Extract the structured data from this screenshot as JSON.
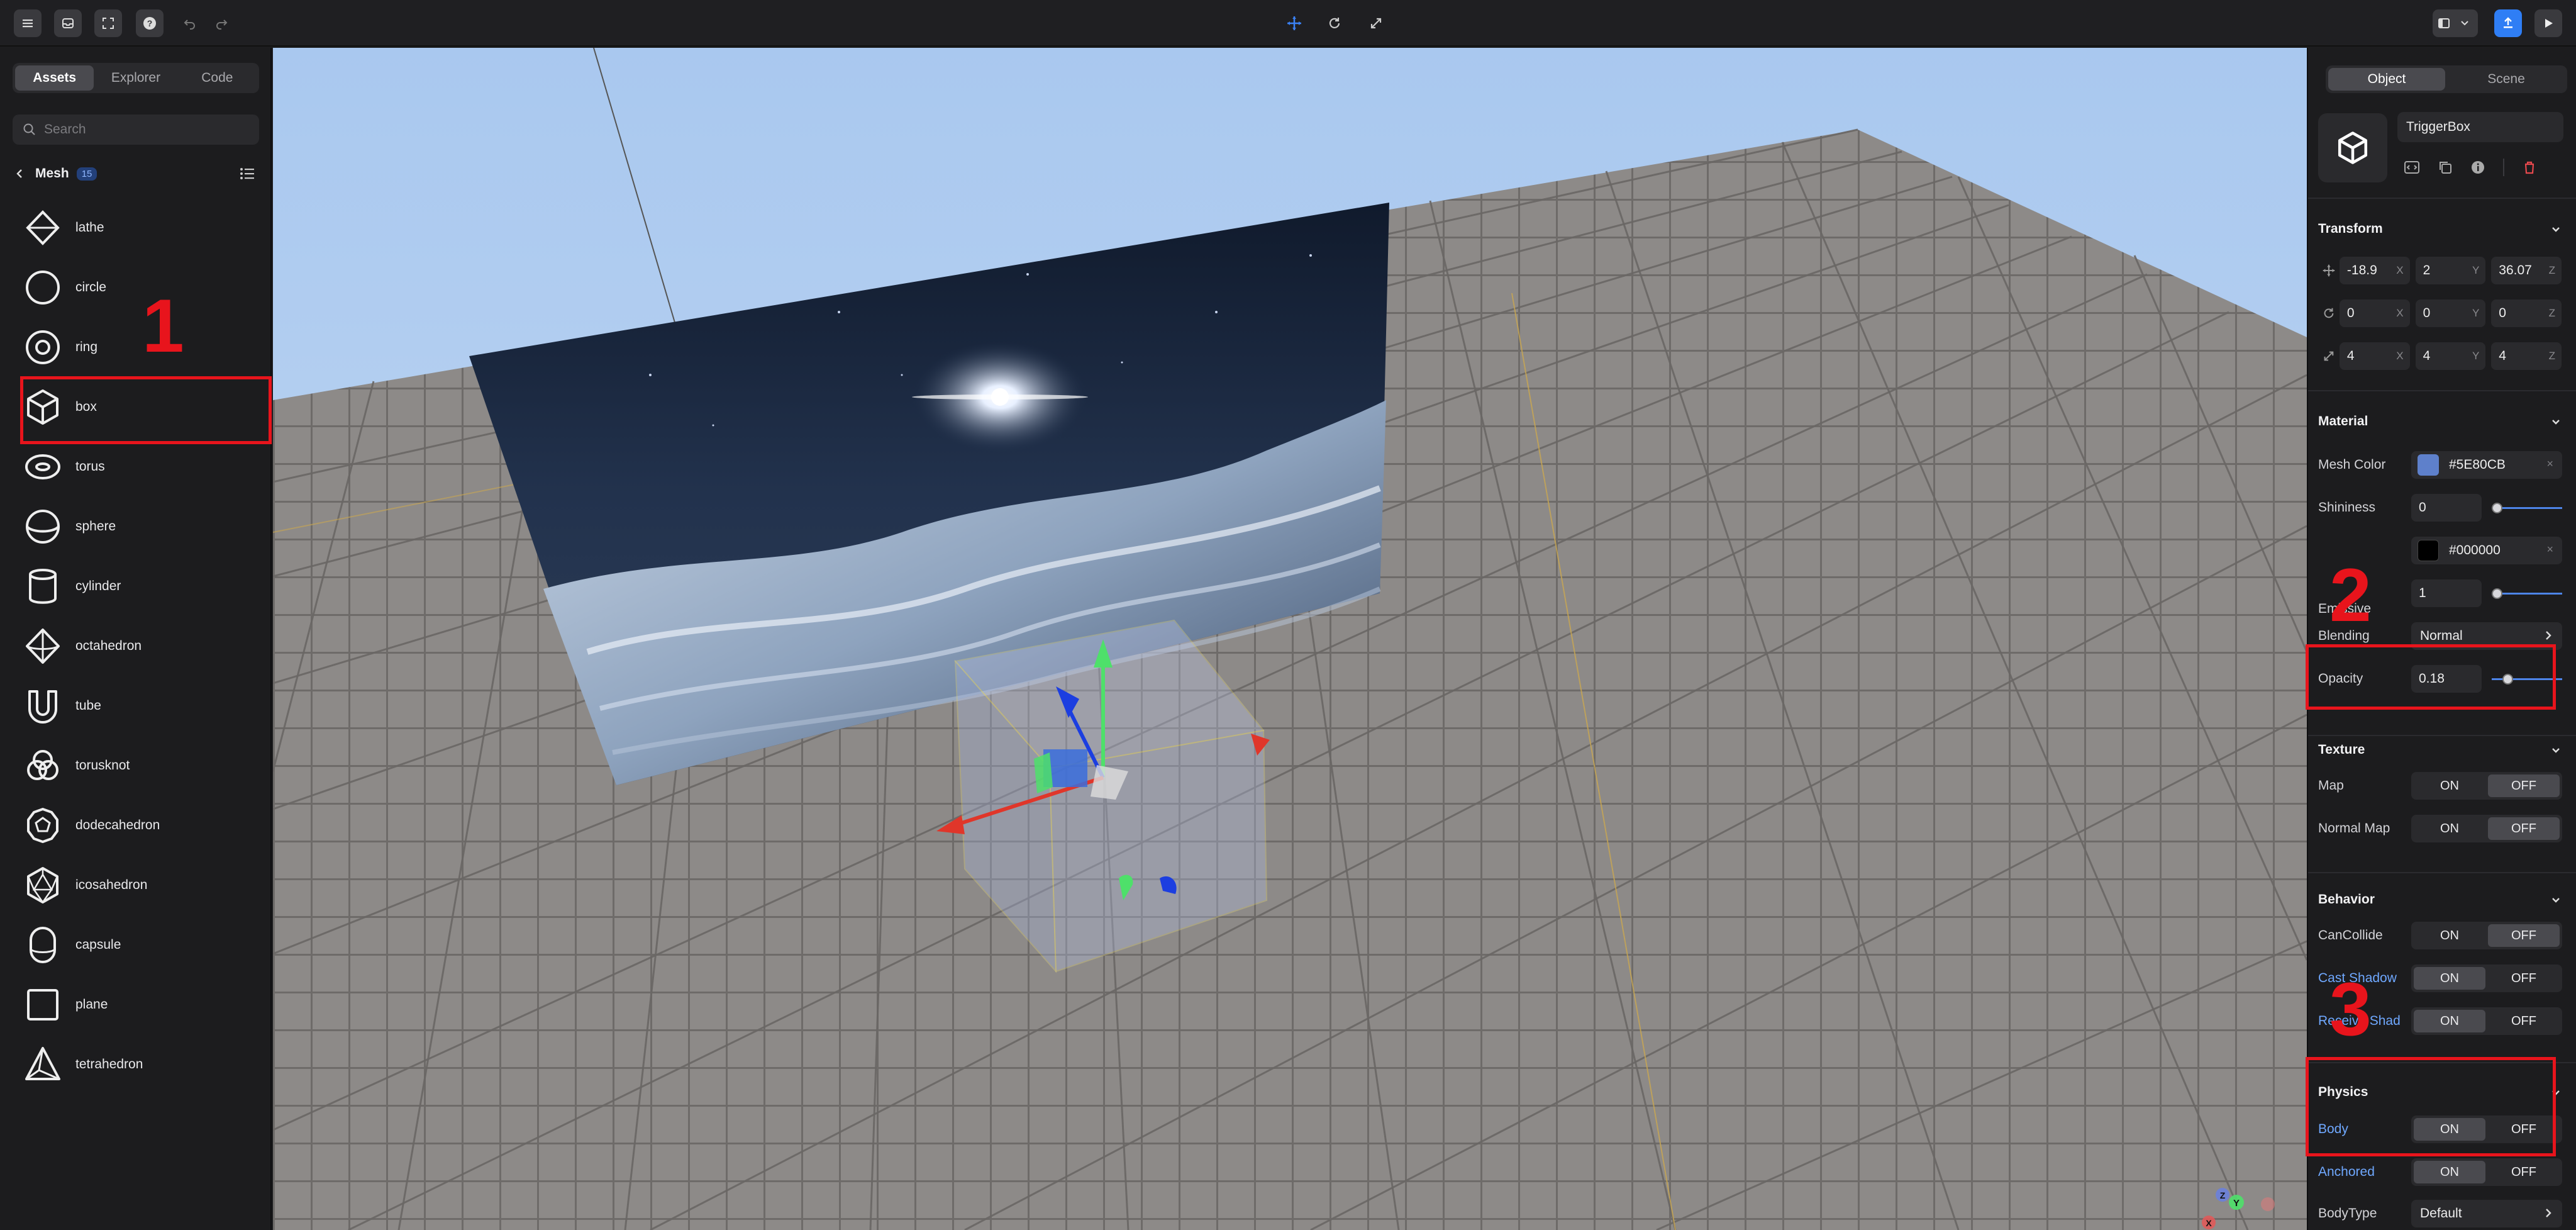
{
  "toolbar": {
    "left_icons": [
      "menu-icon",
      "inbox-icon",
      "fullscreen-icon",
      "help-icon",
      "undo-icon",
      "redo-icon"
    ],
    "center_icons": [
      "move-icon",
      "rotate-icon",
      "scale-icon"
    ],
    "right_icons": [
      "layout-icon",
      "dropdown-icon",
      "publish-icon",
      "play-icon"
    ]
  },
  "left_panel": {
    "tabs": [
      {
        "label": "Assets",
        "active": true
      },
      {
        "label": "Explorer",
        "active": false
      },
      {
        "label": "Code",
        "active": false
      }
    ],
    "search_placeholder": "Search",
    "category": "Mesh",
    "count": "15",
    "meshes": [
      {
        "name": "lathe",
        "icon": "lathe-icon"
      },
      {
        "name": "circle",
        "icon": "circle-icon"
      },
      {
        "name": "ring",
        "icon": "ring-icon"
      },
      {
        "name": "box",
        "icon": "box-icon"
      },
      {
        "name": "torus",
        "icon": "torus-icon"
      },
      {
        "name": "sphere",
        "icon": "sphere-icon"
      },
      {
        "name": "cylinder",
        "icon": "cylinder-icon"
      },
      {
        "name": "octahedron",
        "icon": "octahedron-icon"
      },
      {
        "name": "tube",
        "icon": "tube-icon"
      },
      {
        "name": "torusknot",
        "icon": "torusknot-icon"
      },
      {
        "name": "dodecahedron",
        "icon": "dodecahedron-icon"
      },
      {
        "name": "icosahedron",
        "icon": "icosahedron-icon"
      },
      {
        "name": "capsule",
        "icon": "capsule-icon"
      },
      {
        "name": "plane",
        "icon": "plane-icon"
      },
      {
        "name": "tetrahedron",
        "icon": "tetrahedron-icon"
      }
    ]
  },
  "annotations": {
    "one": "1",
    "two": "2",
    "three": "3"
  },
  "right_panel": {
    "tabs": [
      {
        "label": "Object",
        "active": true
      },
      {
        "label": "Scene",
        "active": false
      }
    ],
    "object_name": "TriggerBox",
    "transform": {
      "title": "Transform",
      "position": {
        "x": "-18.9",
        "y": "2",
        "z": "36.07"
      },
      "rotation": {
        "x": "0",
        "y": "0",
        "z": "0"
      },
      "scale": {
        "x": "4",
        "y": "4",
        "z": "4"
      },
      "axis_labels": {
        "x": "X",
        "y": "Y",
        "z": "Z"
      }
    },
    "material": {
      "title": "Material",
      "mesh_color_label": "Mesh Color",
      "mesh_color": "#5E80CB",
      "shininess_label": "Shininess",
      "shininess": "0",
      "shininess_level": 0,
      "emissive_label": "Emissive",
      "emissive_color": "#000000",
      "emissive_intensity": "1",
      "emissive_level": 0,
      "blending_label": "Blending",
      "blending": "Normal",
      "opacity_label": "Opacity",
      "opacity": "0.18",
      "opacity_level": 0.18
    },
    "texture": {
      "title": "Texture",
      "map_label": "Map",
      "normal_map_label": "Normal Map"
    },
    "behavior": {
      "title": "Behavior",
      "cancollide_label": "CanCollide",
      "cast_shadow_label": "Cast Shadow",
      "receive_shadow_label": "Receive Shad"
    },
    "physics": {
      "title": "Physics",
      "body_label": "Body",
      "anchored_label": "Anchored",
      "bodytype_label": "BodyType",
      "bodytype": "Default"
    },
    "on_label": "ON",
    "off_label": "OFF"
  },
  "gizmo": {
    "y": "Y",
    "z": "Z",
    "x": "X"
  }
}
